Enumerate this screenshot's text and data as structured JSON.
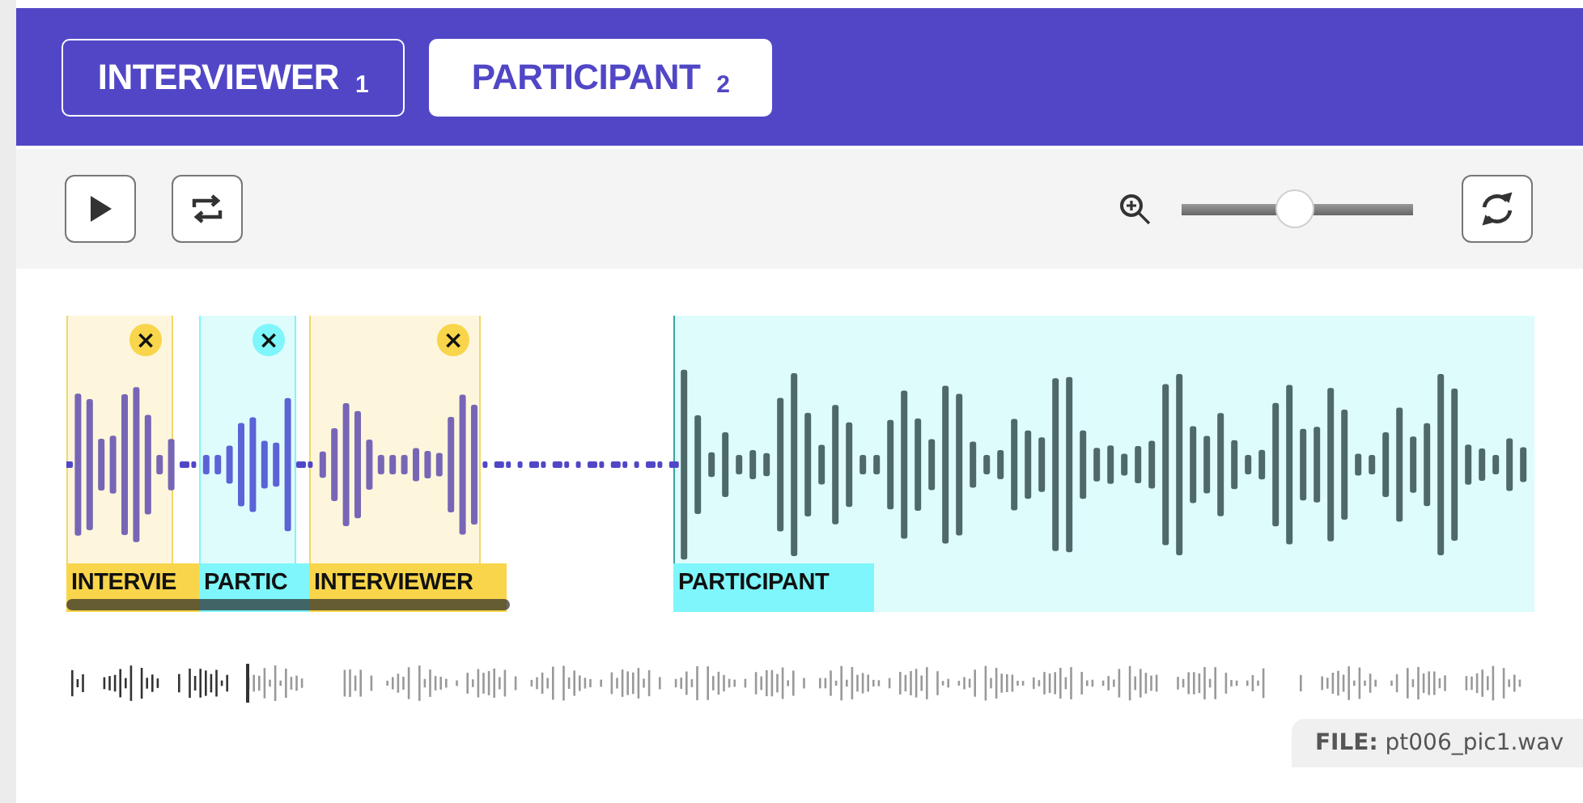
{
  "tabs": [
    {
      "label": "INTERVIEWER",
      "number": "1",
      "selected": false
    },
    {
      "label": "PARTICIPANT",
      "number": "2",
      "selected": true
    }
  ],
  "zoom": {
    "level": 0.49
  },
  "segments": [
    {
      "kind": "interviewer",
      "label": "INTERVIE",
      "close_label": "×"
    },
    {
      "kind": "participant",
      "label": "PARTIC",
      "close_label": "×"
    },
    {
      "kind": "interviewer",
      "label": "INTERVIEWER",
      "close_label": "×"
    },
    {
      "kind": "participant",
      "label": "PARTICIPANT"
    }
  ],
  "file": {
    "text": "**FILE:** pt006_pic1.wav"
  }
}
